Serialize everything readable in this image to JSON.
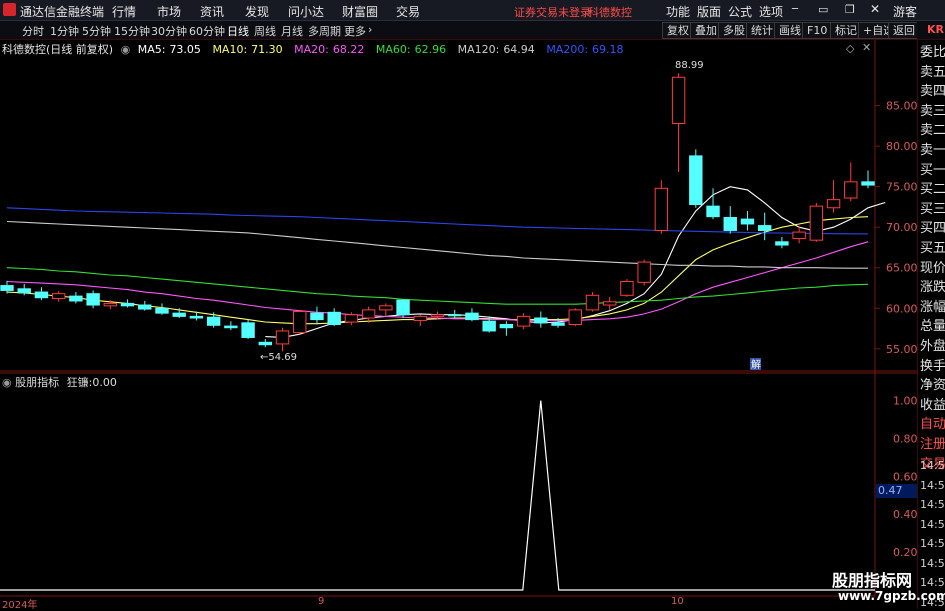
{
  "titlebar": {
    "app_name": "通达信金融终端",
    "menus": [
      "行情",
      "市场",
      "资讯",
      "发现",
      "问小达",
      "财富圈",
      "交易"
    ],
    "warning": "证券交易未登录",
    "stock_name": "科德数控",
    "right_menus": [
      "功能",
      "版面",
      "公式",
      "选项"
    ],
    "guest": "游客"
  },
  "periods": [
    "分时",
    "1分钟",
    "5分钟",
    "15分钟",
    "30分钟",
    "60分钟",
    "日线",
    "周线",
    "月线",
    "多周期",
    "更多"
  ],
  "active_period": "日线",
  "toolbar_buttons": [
    "复权",
    "叠加",
    "多股",
    "统计",
    "画线",
    "F10",
    "标记",
    "+自选",
    "返回"
  ],
  "main_header": {
    "title": "科德数控(日线 前复权)",
    "ma": [
      {
        "label": "MA5:",
        "value": "73.05",
        "color": "#ffffff"
      },
      {
        "label": "MA10:",
        "value": "71.30",
        "color": "#ffff66"
      },
      {
        "label": "MA20:",
        "value": "68.22",
        "color": "#ff55ff"
      },
      {
        "label": "MA60:",
        "value": "62.96",
        "color": "#33dd33"
      },
      {
        "label": "MA120:",
        "value": "64.94",
        "color": "#cccccc"
      },
      {
        "label": "MA200:",
        "value": "69.18",
        "color": "#3355ff"
      }
    ]
  },
  "price_axis": [
    "85.00",
    "80.00",
    "75.00",
    "70.00",
    "65.00",
    "60.00",
    "55.00"
  ],
  "annotations": {
    "high": "88.99",
    "low": "54.69",
    "marker": "解"
  },
  "chart_data": {
    "type": "candlestick",
    "ylim": [
      53,
      91
    ],
    "candles": [
      {
        "o": 62.8,
        "h": 63.4,
        "l": 61.8,
        "c": 62.2
      },
      {
        "o": 62.4,
        "h": 63.0,
        "l": 61.6,
        "c": 61.9
      },
      {
        "o": 62.0,
        "h": 62.6,
        "l": 61.0,
        "c": 61.3
      },
      {
        "o": 61.2,
        "h": 62.1,
        "l": 60.8,
        "c": 61.8
      },
      {
        "o": 61.5,
        "h": 62.0,
        "l": 60.6,
        "c": 60.9
      },
      {
        "o": 61.8,
        "h": 62.2,
        "l": 60.0,
        "c": 60.4
      },
      {
        "o": 60.3,
        "h": 61.0,
        "l": 59.9,
        "c": 60.6
      },
      {
        "o": 60.6,
        "h": 61.1,
        "l": 60.1,
        "c": 60.3
      },
      {
        "o": 60.4,
        "h": 60.9,
        "l": 59.7,
        "c": 59.9
      },
      {
        "o": 60.0,
        "h": 60.6,
        "l": 59.2,
        "c": 59.4
      },
      {
        "o": 59.4,
        "h": 60.0,
        "l": 58.8,
        "c": 59.0
      },
      {
        "o": 59.0,
        "h": 59.6,
        "l": 58.5,
        "c": 58.8
      },
      {
        "o": 58.9,
        "h": 59.5,
        "l": 57.6,
        "c": 57.9
      },
      {
        "o": 57.8,
        "h": 58.4,
        "l": 57.3,
        "c": 57.6
      },
      {
        "o": 58.2,
        "h": 58.6,
        "l": 56.2,
        "c": 56.4
      },
      {
        "o": 55.8,
        "h": 56.2,
        "l": 55.2,
        "c": 55.5
      },
      {
        "o": 55.6,
        "h": 57.6,
        "l": 54.7,
        "c": 57.2
      },
      {
        "o": 57.0,
        "h": 59.8,
        "l": 56.8,
        "c": 59.6
      },
      {
        "o": 59.4,
        "h": 60.2,
        "l": 58.0,
        "c": 58.6
      },
      {
        "o": 59.5,
        "h": 60.0,
        "l": 57.8,
        "c": 58.0
      },
      {
        "o": 58.3,
        "h": 59.5,
        "l": 57.9,
        "c": 59.2
      },
      {
        "o": 58.8,
        "h": 60.2,
        "l": 58.2,
        "c": 59.8
      },
      {
        "o": 59.8,
        "h": 60.6,
        "l": 59.1,
        "c": 60.3
      },
      {
        "o": 61.0,
        "h": 61.1,
        "l": 58.8,
        "c": 59.2
      },
      {
        "o": 58.5,
        "h": 59.2,
        "l": 57.8,
        "c": 59.0
      },
      {
        "o": 59.0,
        "h": 59.6,
        "l": 58.6,
        "c": 59.2
      },
      {
        "o": 59.2,
        "h": 59.8,
        "l": 58.8,
        "c": 59.1
      },
      {
        "o": 59.4,
        "h": 60.0,
        "l": 58.4,
        "c": 58.6
      },
      {
        "o": 58.4,
        "h": 59.0,
        "l": 57.0,
        "c": 57.2
      },
      {
        "o": 58.0,
        "h": 58.4,
        "l": 56.6,
        "c": 57.6
      },
      {
        "o": 57.8,
        "h": 59.4,
        "l": 57.4,
        "c": 59.0
      },
      {
        "o": 58.8,
        "h": 59.6,
        "l": 57.6,
        "c": 58.2
      },
      {
        "o": 58.2,
        "h": 58.8,
        "l": 57.6,
        "c": 57.9
      },
      {
        "o": 58.0,
        "h": 60.0,
        "l": 57.8,
        "c": 59.8
      },
      {
        "o": 59.8,
        "h": 62.0,
        "l": 59.6,
        "c": 61.6
      },
      {
        "o": 60.4,
        "h": 61.4,
        "l": 59.8,
        "c": 60.8
      },
      {
        "o": 61.6,
        "h": 63.6,
        "l": 61.4,
        "c": 63.3
      },
      {
        "o": 63.2,
        "h": 66.0,
        "l": 62.8,
        "c": 65.7
      },
      {
        "o": 69.6,
        "h": 75.8,
        "l": 69.2,
        "c": 74.8
      },
      {
        "o": 82.8,
        "h": 88.99,
        "l": 76.8,
        "c": 88.5
      },
      {
        "o": 78.8,
        "h": 79.6,
        "l": 72.4,
        "c": 72.8
      },
      {
        "o": 72.6,
        "h": 74.8,
        "l": 71.0,
        "c": 71.3
      },
      {
        "o": 71.2,
        "h": 72.6,
        "l": 69.2,
        "c": 69.6
      },
      {
        "o": 71.0,
        "h": 72.0,
        "l": 69.6,
        "c": 70.4
      },
      {
        "o": 70.2,
        "h": 71.8,
        "l": 68.4,
        "c": 69.6
      },
      {
        "o": 68.2,
        "h": 68.8,
        "l": 67.4,
        "c": 67.8
      },
      {
        "o": 68.6,
        "h": 70.2,
        "l": 68.0,
        "c": 69.4
      },
      {
        "o": 68.4,
        "h": 73.0,
        "l": 68.2,
        "c": 72.6
      },
      {
        "o": 72.4,
        "h": 75.8,
        "l": 71.8,
        "c": 73.4
      },
      {
        "o": 73.6,
        "h": 78.0,
        "l": 73.2,
        "c": 75.6
      },
      {
        "o": 75.6,
        "h": 77.0,
        "l": 74.8,
        "c": 75.2
      }
    ],
    "ma_series": [
      {
        "name": "MA5",
        "color": "#ffffff",
        "start": 15,
        "values": [
          56.5,
          56.4,
          56.8,
          57.5,
          58.2,
          58.5,
          58.8,
          59.0,
          59.2,
          59.3,
          59.2,
          59.2,
          59.1,
          58.9,
          58.7,
          58.4,
          58.2,
          58.3,
          58.6,
          59.1,
          59.7,
          60.6,
          61.8,
          64.2,
          68.9,
          72.0,
          74.0,
          75.0,
          74.6,
          73.0,
          71.2,
          70.0,
          69.5,
          70.0,
          71.0,
          72.4,
          73.05
        ]
      },
      {
        "name": "MA10",
        "color": "#ffff66",
        "start": 0,
        "values": [
          62.0,
          61.9,
          61.7,
          61.5,
          61.3,
          61.0,
          60.8,
          60.6,
          60.3,
          60.1,
          59.8,
          59.5,
          59.2,
          58.9,
          58.6,
          58.3,
          58.2,
          58.1,
          58.1,
          58.2,
          58.3,
          58.4,
          58.5,
          58.6,
          58.6,
          58.7,
          58.8,
          58.8,
          58.7,
          58.6,
          58.6,
          58.6,
          58.6,
          58.7,
          59.0,
          59.3,
          59.8,
          60.6,
          62.0,
          64.0,
          66.0,
          67.2,
          68.0,
          68.7,
          69.4,
          70.0,
          70.4,
          70.8,
          71.0,
          71.2,
          71.3
        ]
      },
      {
        "name": "MA20",
        "color": "#ff55ff",
        "start": 0,
        "values": [
          63.3,
          63.2,
          63.1,
          63.0,
          62.9,
          62.7,
          62.5,
          62.3,
          62.0,
          61.8,
          61.5,
          61.2,
          61.0,
          60.7,
          60.4,
          60.1,
          59.9,
          59.7,
          59.5,
          59.4,
          59.2,
          59.1,
          59.0,
          58.9,
          58.8,
          58.8,
          58.7,
          58.7,
          58.6,
          58.6,
          58.5,
          58.5,
          58.5,
          58.5,
          58.6,
          58.7,
          58.9,
          59.3,
          59.9,
          60.8,
          61.8,
          62.6,
          63.2,
          63.8,
          64.4,
          65.0,
          65.6,
          66.2,
          66.9,
          67.6,
          68.2
        ]
      },
      {
        "name": "MA60",
        "color": "#33dd33",
        "start": 0,
        "values": [
          65.0,
          64.9,
          64.8,
          64.6,
          64.5,
          64.3,
          64.1,
          64.0,
          63.8,
          63.6,
          63.4,
          63.2,
          63.0,
          62.8,
          62.6,
          62.4,
          62.2,
          62.0,
          61.8,
          61.7,
          61.5,
          61.4,
          61.3,
          61.1,
          61.0,
          60.9,
          60.8,
          60.7,
          60.6,
          60.5,
          60.5,
          60.5,
          60.5,
          60.5,
          60.6,
          60.7,
          60.8,
          60.9,
          61.0,
          61.2,
          61.4,
          61.5,
          61.7,
          61.9,
          62.1,
          62.3,
          62.5,
          62.6,
          62.8,
          62.9,
          62.96
        ]
      },
      {
        "name": "MA120",
        "color": "#cccccc",
        "start": 0,
        "values": [
          70.7,
          70.6,
          70.5,
          70.4,
          70.3,
          70.2,
          70.1,
          70.0,
          69.9,
          69.8,
          69.7,
          69.6,
          69.5,
          69.4,
          69.3,
          69.1,
          68.9,
          68.7,
          68.5,
          68.3,
          68.1,
          67.9,
          67.7,
          67.5,
          67.3,
          67.1,
          66.9,
          66.7,
          66.5,
          66.4,
          66.2,
          66.1,
          66.0,
          65.9,
          65.8,
          65.7,
          65.6,
          65.5,
          65.4,
          65.3,
          65.3,
          65.2,
          65.2,
          65.1,
          65.1,
          65.0,
          65.0,
          65.0,
          64.95,
          64.94,
          64.94
        ]
      },
      {
        "name": "MA200",
        "color": "#2b44ee",
        "start": 0,
        "values": [
          72.4,
          72.3,
          72.2,
          72.1,
          72.0,
          71.95,
          71.9,
          71.85,
          71.8,
          71.75,
          71.7,
          71.65,
          71.6,
          71.5,
          71.45,
          71.4,
          71.35,
          71.3,
          71.2,
          71.1,
          71.0,
          70.9,
          70.8,
          70.7,
          70.6,
          70.5,
          70.4,
          70.3,
          70.2,
          70.1,
          70.0,
          69.95,
          69.9,
          69.85,
          69.8,
          69.75,
          69.7,
          69.65,
          69.6,
          69.55,
          69.5,
          69.45,
          69.4,
          69.35,
          69.3,
          69.28,
          69.25,
          69.22,
          69.2,
          69.19,
          69.18
        ]
      }
    ],
    "sub_indicator": {
      "ylim": [
        0,
        1.05
      ],
      "spike_index": 31,
      "spike_value": 1.0
    }
  },
  "sub_header": {
    "name": "股朋指标",
    "series_label": "狂镰:",
    "series_value": "0.00"
  },
  "sub_axis": [
    "1.00",
    "0.80",
    "0.60",
    "0.40",
    "0.20"
  ],
  "sub_current": "0.47",
  "date_axis": [
    "2024年",
    "9",
    "10"
  ],
  "quote_panel": {
    "items": [
      "委比",
      "卖五",
      "卖四",
      "卖三",
      "卖二",
      "卖一",
      "买一",
      "买二",
      "买三",
      "买四",
      "买五",
      "现价",
      "涨跌",
      "涨幅",
      "总量",
      "外盘",
      "换手",
      "净资",
      "收益",
      "自动",
      "注册",
      "交易"
    ],
    "kr_tag": "KR",
    "times": [
      "14:56",
      "14:56",
      "14:56",
      "14:56",
      "14:56",
      "14:56",
      "14:56",
      "14:56"
    ]
  },
  "watermark": {
    "line1": "股朋指标网",
    "line2": "www.7gpzb.com"
  }
}
